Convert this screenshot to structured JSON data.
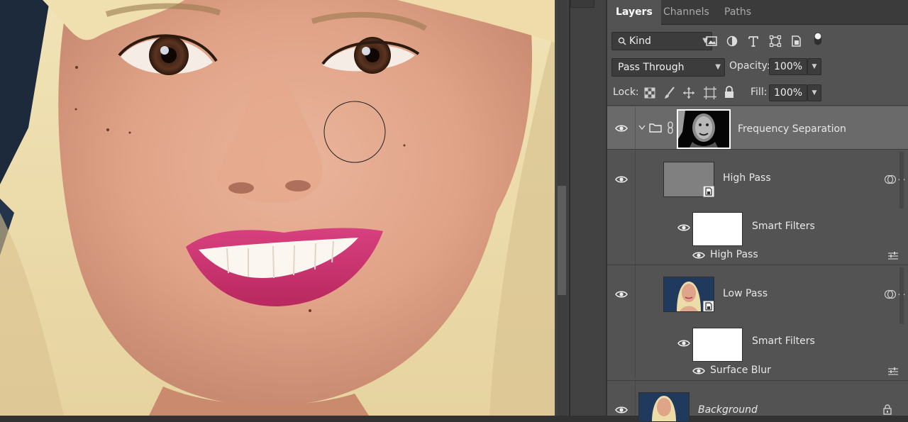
{
  "panel": {
    "tabs": [
      {
        "label": "Layers"
      },
      {
        "label": "Channels"
      },
      {
        "label": "Paths"
      }
    ],
    "filter": {
      "label": "Kind",
      "icons": [
        "image-filter-icon",
        "adjustment-filter-icon",
        "type-filter-icon",
        "shape-filter-icon",
        "smart-object-filter-icon",
        "filter-toggle-icon"
      ]
    },
    "blend_mode": "Pass Through",
    "opacity_label": "Opacity:",
    "opacity_value": "100%",
    "lock_label": "Lock:",
    "lock_icons": [
      "lock-transparent-icon",
      "lock-paint-icon",
      "lock-position-icon",
      "lock-artboard-icon",
      "lock-all-icon"
    ],
    "fill_label": "Fill:",
    "fill_value": "100%",
    "layers": [
      {
        "name": "Frequency Separation",
        "kind": "group",
        "selected": true
      },
      {
        "name": "High Pass",
        "kind": "smart-object"
      },
      {
        "name": "Smart Filters",
        "kind": "smart-filters"
      },
      {
        "name": "High Pass",
        "kind": "filter"
      },
      {
        "name": "Low Pass",
        "kind": "smart-object"
      },
      {
        "name": "Smart Filters",
        "kind": "smart-filters"
      },
      {
        "name": "Surface Blur",
        "kind": "filter"
      },
      {
        "name": "Background",
        "kind": "background",
        "locked": true
      }
    ]
  },
  "colors": {
    "panel_bg": "#535353",
    "selected_row": "#6a6a6a",
    "tab_bar": "#3b3b3b",
    "canvas_skin": "#e3a88e",
    "lipstick": "#d2357a"
  }
}
